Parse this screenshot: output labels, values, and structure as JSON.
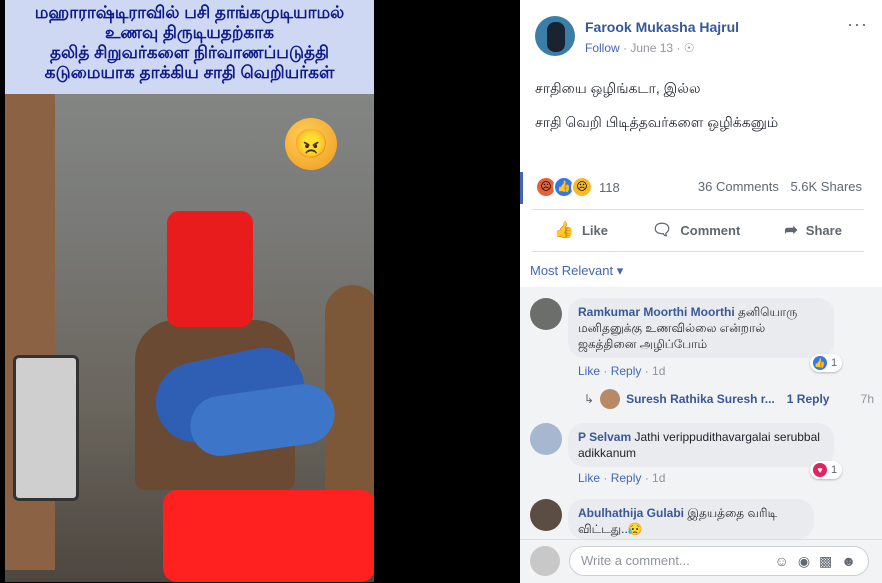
{
  "photo": {
    "caption_lines": [
      "மஹாராஷ்டிராவில்   பசி தாங்கமுடியாமல்",
      "உணவு திருடியதற்காக",
      "தலித் சிறுவர்களை  நிர்வாணப்படுத்தி",
      "கடுமையாக தாக்கிய சாதி வெறியர்கள்"
    ],
    "emoji": "😠"
  },
  "post": {
    "author": "Farook Mukasha Hajrul",
    "follow": "Follow",
    "date": "June 13",
    "dot": "·",
    "more": "···",
    "text1": "சாதியை ஒழிங்கடா, இல்ல",
    "text2": "சாதி வெறி பிடித்தவர்களை ஒழிக்கனும்",
    "reaction_count": "118",
    "comments": "36 Comments",
    "shares": "5.6K Shares",
    "actions": {
      "like": "Like",
      "comment": "Comment",
      "share": "Share"
    },
    "sort": "Most Relevant ▾"
  },
  "comments": [
    {
      "name": "Ramkumar Moorthi Moorthi",
      "text": " தனியொரு மனிதனுக்கு உணவில்லை என்றால் ஜகத்தினை அழிப்போம்",
      "like": "Like",
      "reply": "Reply",
      "time": "1d",
      "react_count": "1"
    },
    {
      "name": "P Selvam",
      "text": " Jathi verippudithavargalai serubbal adikkanum",
      "like": "Like",
      "reply": "Reply",
      "time": "1d",
      "react_count": "1"
    },
    {
      "name": "Abulhathija Gulabi",
      "text": " இதயத்தை வரிடி விட்டது..😥"
    }
  ],
  "reply_thread": {
    "name": "Suresh Rathika Suresh r...",
    "count": "1 Reply",
    "time": "7h"
  },
  "composer": {
    "placeholder": "Write a comment..."
  }
}
